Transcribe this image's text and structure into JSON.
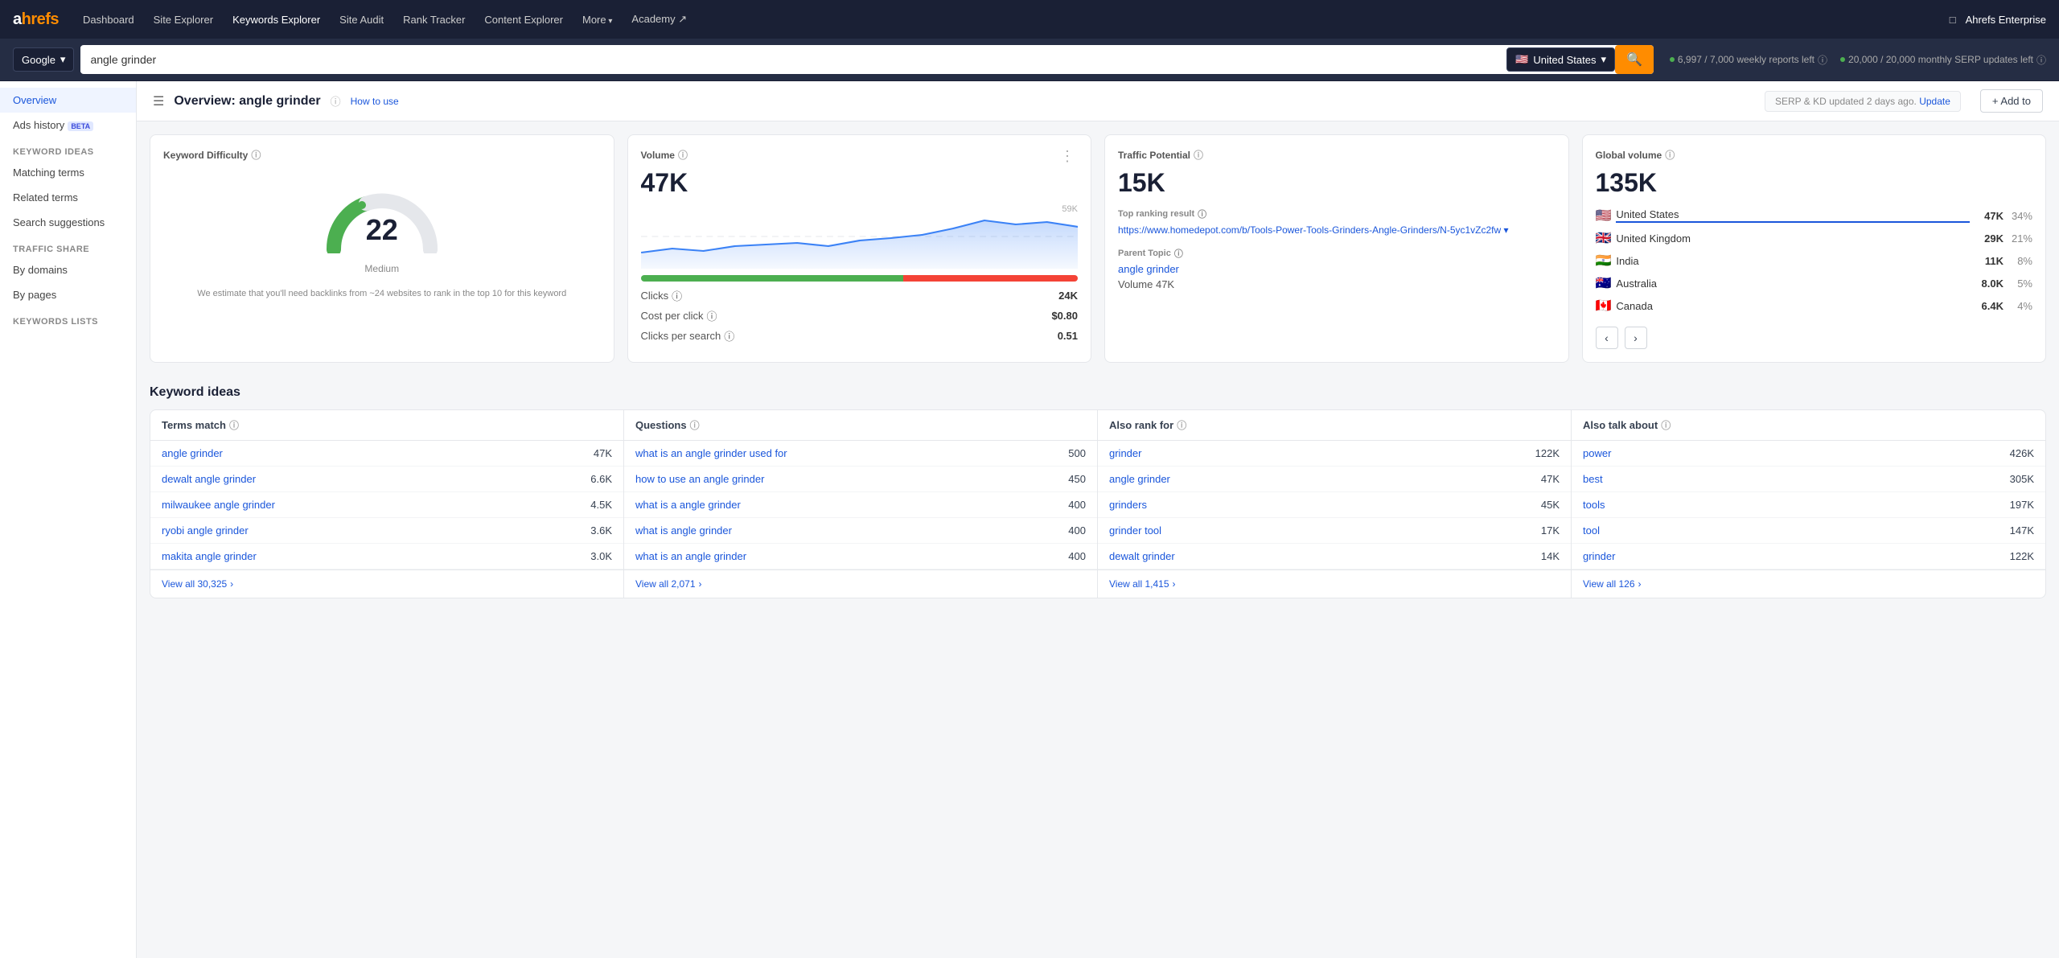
{
  "nav": {
    "logo": "ahrefs",
    "items": [
      {
        "label": "Dashboard",
        "active": false
      },
      {
        "label": "Site Explorer",
        "active": false
      },
      {
        "label": "Keywords Explorer",
        "active": true
      },
      {
        "label": "Site Audit",
        "active": false
      },
      {
        "label": "Rank Tracker",
        "active": false
      },
      {
        "label": "Content Explorer",
        "active": false
      },
      {
        "label": "More",
        "active": false,
        "has_arrow": true
      },
      {
        "label": "Academy ↗",
        "active": false
      }
    ],
    "right": {
      "monitor_icon": "□",
      "account": "Ahrefs Enterprise"
    }
  },
  "searchbar": {
    "engine": "Google",
    "query": "angle grinder",
    "country": "United States",
    "quota1": "6,997 / 7,000 weekly reports left",
    "quota2": "20,000 / 20,000 monthly SERP updates left"
  },
  "sidebar": {
    "overview": "Overview",
    "ads_history": "Ads history",
    "ads_badge": "BETA",
    "sections": [
      {
        "title": "Keyword ideas",
        "items": [
          "Matching terms",
          "Related terms",
          "Search suggestions"
        ]
      },
      {
        "title": "Traffic share",
        "items": [
          "By domains",
          "By pages"
        ]
      },
      {
        "title": "Keywords lists",
        "items": []
      }
    ]
  },
  "page_header": {
    "title": "Overview: angle grinder",
    "how_to": "How to use",
    "serp_update": "SERP & KD updated 2 days ago.",
    "update_link": "Update",
    "add_to": "+ Add to"
  },
  "kd_card": {
    "title": "Keyword Difficulty",
    "value": "22",
    "label": "Medium",
    "note": "We estimate that you'll need backlinks from ~24 websites to rank in the top 10 for this keyword"
  },
  "volume_card": {
    "title": "Volume",
    "value": "47K",
    "top_label": "59K",
    "clicks_label": "Clicks",
    "clicks_info": true,
    "clicks_value": "24K",
    "cpc_label": "Cost per click",
    "cpc_info": true,
    "cpc_value": "$0.80",
    "cps_label": "Clicks per search",
    "cps_info": true,
    "cps_value": "0.51",
    "more_btn": "⋮"
  },
  "traffic_card": {
    "title": "Traffic Potential",
    "value": "15K",
    "top_result_label": "Top ranking result",
    "top_result_url": "https://www.homedepot.com/b/Tools-Power-Tools-Grinders-Angle-Grinders/N-5yc1vZc2fw",
    "parent_topic_label": "Parent Topic",
    "parent_topic_link": "angle grinder",
    "volume_label": "Volume 47K"
  },
  "global_card": {
    "title": "Global volume",
    "value": "135K",
    "countries": [
      {
        "flag": "🇺🇸",
        "name": "United States",
        "underline": true,
        "vol": "47K",
        "pct": "34%"
      },
      {
        "flag": "🇬🇧",
        "name": "United Kingdom",
        "underline": false,
        "vol": "29K",
        "pct": "21%"
      },
      {
        "flag": "🇮🇳",
        "name": "India",
        "underline": false,
        "vol": "11K",
        "pct": "8%"
      },
      {
        "flag": "🇦🇺",
        "name": "Australia",
        "underline": false,
        "vol": "8.0K",
        "pct": "5%"
      },
      {
        "flag": "🇨🇦",
        "name": "Canada",
        "underline": false,
        "vol": "6.4K",
        "pct": "4%"
      }
    ],
    "nav_prev": "‹",
    "nav_next": "›"
  },
  "keyword_ideas": {
    "section_title": "Keyword ideas",
    "columns": [
      {
        "header": "Terms match",
        "info": true,
        "rows": [
          {
            "label": "angle grinder",
            "value": "47K"
          },
          {
            "label": "dewalt angle grinder",
            "value": "6.6K"
          },
          {
            "label": "milwaukee angle grinder",
            "value": "4.5K"
          },
          {
            "label": "ryobi angle grinder",
            "value": "3.6K"
          },
          {
            "label": "makita angle grinder",
            "value": "3.0K"
          }
        ],
        "view_all": "View all 30,325",
        "view_all_arrow": "›"
      },
      {
        "header": "Questions",
        "info": true,
        "rows": [
          {
            "label": "what is an angle grinder used for",
            "value": "500"
          },
          {
            "label": "how to use an angle grinder",
            "value": "450"
          },
          {
            "label": "what is a angle grinder",
            "value": "400"
          },
          {
            "label": "what is angle grinder",
            "value": "400"
          },
          {
            "label": "what is an angle grinder",
            "value": "400"
          }
        ],
        "view_all": "View all 2,071",
        "view_all_arrow": "›"
      },
      {
        "header": "Also rank for",
        "info": true,
        "rows": [
          {
            "label": "grinder",
            "value": "122K"
          },
          {
            "label": "angle grinder",
            "value": "47K"
          },
          {
            "label": "grinders",
            "value": "45K"
          },
          {
            "label": "grinder tool",
            "value": "17K"
          },
          {
            "label": "dewalt grinder",
            "value": "14K"
          }
        ],
        "view_all": "View all 1,415",
        "view_all_arrow": "›"
      },
      {
        "header": "Also talk about",
        "info": true,
        "rows": [
          {
            "label": "power",
            "value": "426K"
          },
          {
            "label": "best",
            "value": "305K"
          },
          {
            "label": "tools",
            "value": "197K"
          },
          {
            "label": "tool",
            "value": "147K"
          },
          {
            "label": "grinder",
            "value": "122K"
          }
        ],
        "view_all": "View all 126",
        "view_all_arrow": "›"
      }
    ]
  }
}
